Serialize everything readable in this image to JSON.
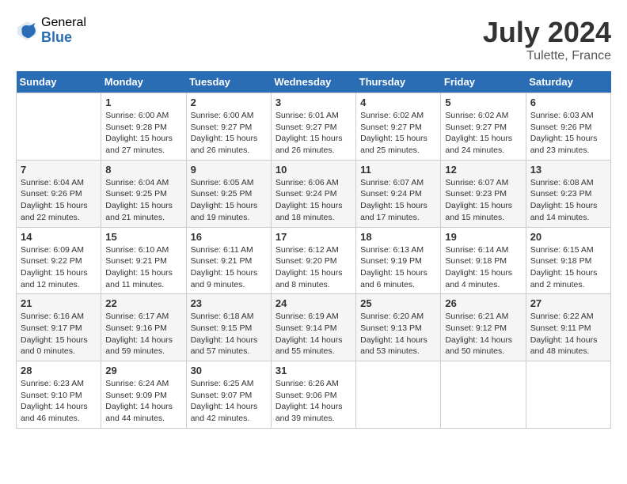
{
  "header": {
    "logo_general": "General",
    "logo_blue": "Blue",
    "month_year": "July 2024",
    "location": "Tulette, France"
  },
  "days_of_week": [
    "Sunday",
    "Monday",
    "Tuesday",
    "Wednesday",
    "Thursday",
    "Friday",
    "Saturday"
  ],
  "weeks": [
    [
      {
        "day": "",
        "info": ""
      },
      {
        "day": "1",
        "info": "Sunrise: 6:00 AM\nSunset: 9:28 PM\nDaylight: 15 hours\nand 27 minutes."
      },
      {
        "day": "2",
        "info": "Sunrise: 6:00 AM\nSunset: 9:27 PM\nDaylight: 15 hours\nand 26 minutes."
      },
      {
        "day": "3",
        "info": "Sunrise: 6:01 AM\nSunset: 9:27 PM\nDaylight: 15 hours\nand 26 minutes."
      },
      {
        "day": "4",
        "info": "Sunrise: 6:02 AM\nSunset: 9:27 PM\nDaylight: 15 hours\nand 25 minutes."
      },
      {
        "day": "5",
        "info": "Sunrise: 6:02 AM\nSunset: 9:27 PM\nDaylight: 15 hours\nand 24 minutes."
      },
      {
        "day": "6",
        "info": "Sunrise: 6:03 AM\nSunset: 9:26 PM\nDaylight: 15 hours\nand 23 minutes."
      }
    ],
    [
      {
        "day": "7",
        "info": "Sunrise: 6:04 AM\nSunset: 9:26 PM\nDaylight: 15 hours\nand 22 minutes."
      },
      {
        "day": "8",
        "info": "Sunrise: 6:04 AM\nSunset: 9:25 PM\nDaylight: 15 hours\nand 21 minutes."
      },
      {
        "day": "9",
        "info": "Sunrise: 6:05 AM\nSunset: 9:25 PM\nDaylight: 15 hours\nand 19 minutes."
      },
      {
        "day": "10",
        "info": "Sunrise: 6:06 AM\nSunset: 9:24 PM\nDaylight: 15 hours\nand 18 minutes."
      },
      {
        "day": "11",
        "info": "Sunrise: 6:07 AM\nSunset: 9:24 PM\nDaylight: 15 hours\nand 17 minutes."
      },
      {
        "day": "12",
        "info": "Sunrise: 6:07 AM\nSunset: 9:23 PM\nDaylight: 15 hours\nand 15 minutes."
      },
      {
        "day": "13",
        "info": "Sunrise: 6:08 AM\nSunset: 9:23 PM\nDaylight: 15 hours\nand 14 minutes."
      }
    ],
    [
      {
        "day": "14",
        "info": "Sunrise: 6:09 AM\nSunset: 9:22 PM\nDaylight: 15 hours\nand 12 minutes."
      },
      {
        "day": "15",
        "info": "Sunrise: 6:10 AM\nSunset: 9:21 PM\nDaylight: 15 hours\nand 11 minutes."
      },
      {
        "day": "16",
        "info": "Sunrise: 6:11 AM\nSunset: 9:21 PM\nDaylight: 15 hours\nand 9 minutes."
      },
      {
        "day": "17",
        "info": "Sunrise: 6:12 AM\nSunset: 9:20 PM\nDaylight: 15 hours\nand 8 minutes."
      },
      {
        "day": "18",
        "info": "Sunrise: 6:13 AM\nSunset: 9:19 PM\nDaylight: 15 hours\nand 6 minutes."
      },
      {
        "day": "19",
        "info": "Sunrise: 6:14 AM\nSunset: 9:18 PM\nDaylight: 15 hours\nand 4 minutes."
      },
      {
        "day": "20",
        "info": "Sunrise: 6:15 AM\nSunset: 9:18 PM\nDaylight: 15 hours\nand 2 minutes."
      }
    ],
    [
      {
        "day": "21",
        "info": "Sunrise: 6:16 AM\nSunset: 9:17 PM\nDaylight: 15 hours\nand 0 minutes."
      },
      {
        "day": "22",
        "info": "Sunrise: 6:17 AM\nSunset: 9:16 PM\nDaylight: 14 hours\nand 59 minutes."
      },
      {
        "day": "23",
        "info": "Sunrise: 6:18 AM\nSunset: 9:15 PM\nDaylight: 14 hours\nand 57 minutes."
      },
      {
        "day": "24",
        "info": "Sunrise: 6:19 AM\nSunset: 9:14 PM\nDaylight: 14 hours\nand 55 minutes."
      },
      {
        "day": "25",
        "info": "Sunrise: 6:20 AM\nSunset: 9:13 PM\nDaylight: 14 hours\nand 53 minutes."
      },
      {
        "day": "26",
        "info": "Sunrise: 6:21 AM\nSunset: 9:12 PM\nDaylight: 14 hours\nand 50 minutes."
      },
      {
        "day": "27",
        "info": "Sunrise: 6:22 AM\nSunset: 9:11 PM\nDaylight: 14 hours\nand 48 minutes."
      }
    ],
    [
      {
        "day": "28",
        "info": "Sunrise: 6:23 AM\nSunset: 9:10 PM\nDaylight: 14 hours\nand 46 minutes."
      },
      {
        "day": "29",
        "info": "Sunrise: 6:24 AM\nSunset: 9:09 PM\nDaylight: 14 hours\nand 44 minutes."
      },
      {
        "day": "30",
        "info": "Sunrise: 6:25 AM\nSunset: 9:07 PM\nDaylight: 14 hours\nand 42 minutes."
      },
      {
        "day": "31",
        "info": "Sunrise: 6:26 AM\nSunset: 9:06 PM\nDaylight: 14 hours\nand 39 minutes."
      },
      {
        "day": "",
        "info": ""
      },
      {
        "day": "",
        "info": ""
      },
      {
        "day": "",
        "info": ""
      }
    ]
  ]
}
